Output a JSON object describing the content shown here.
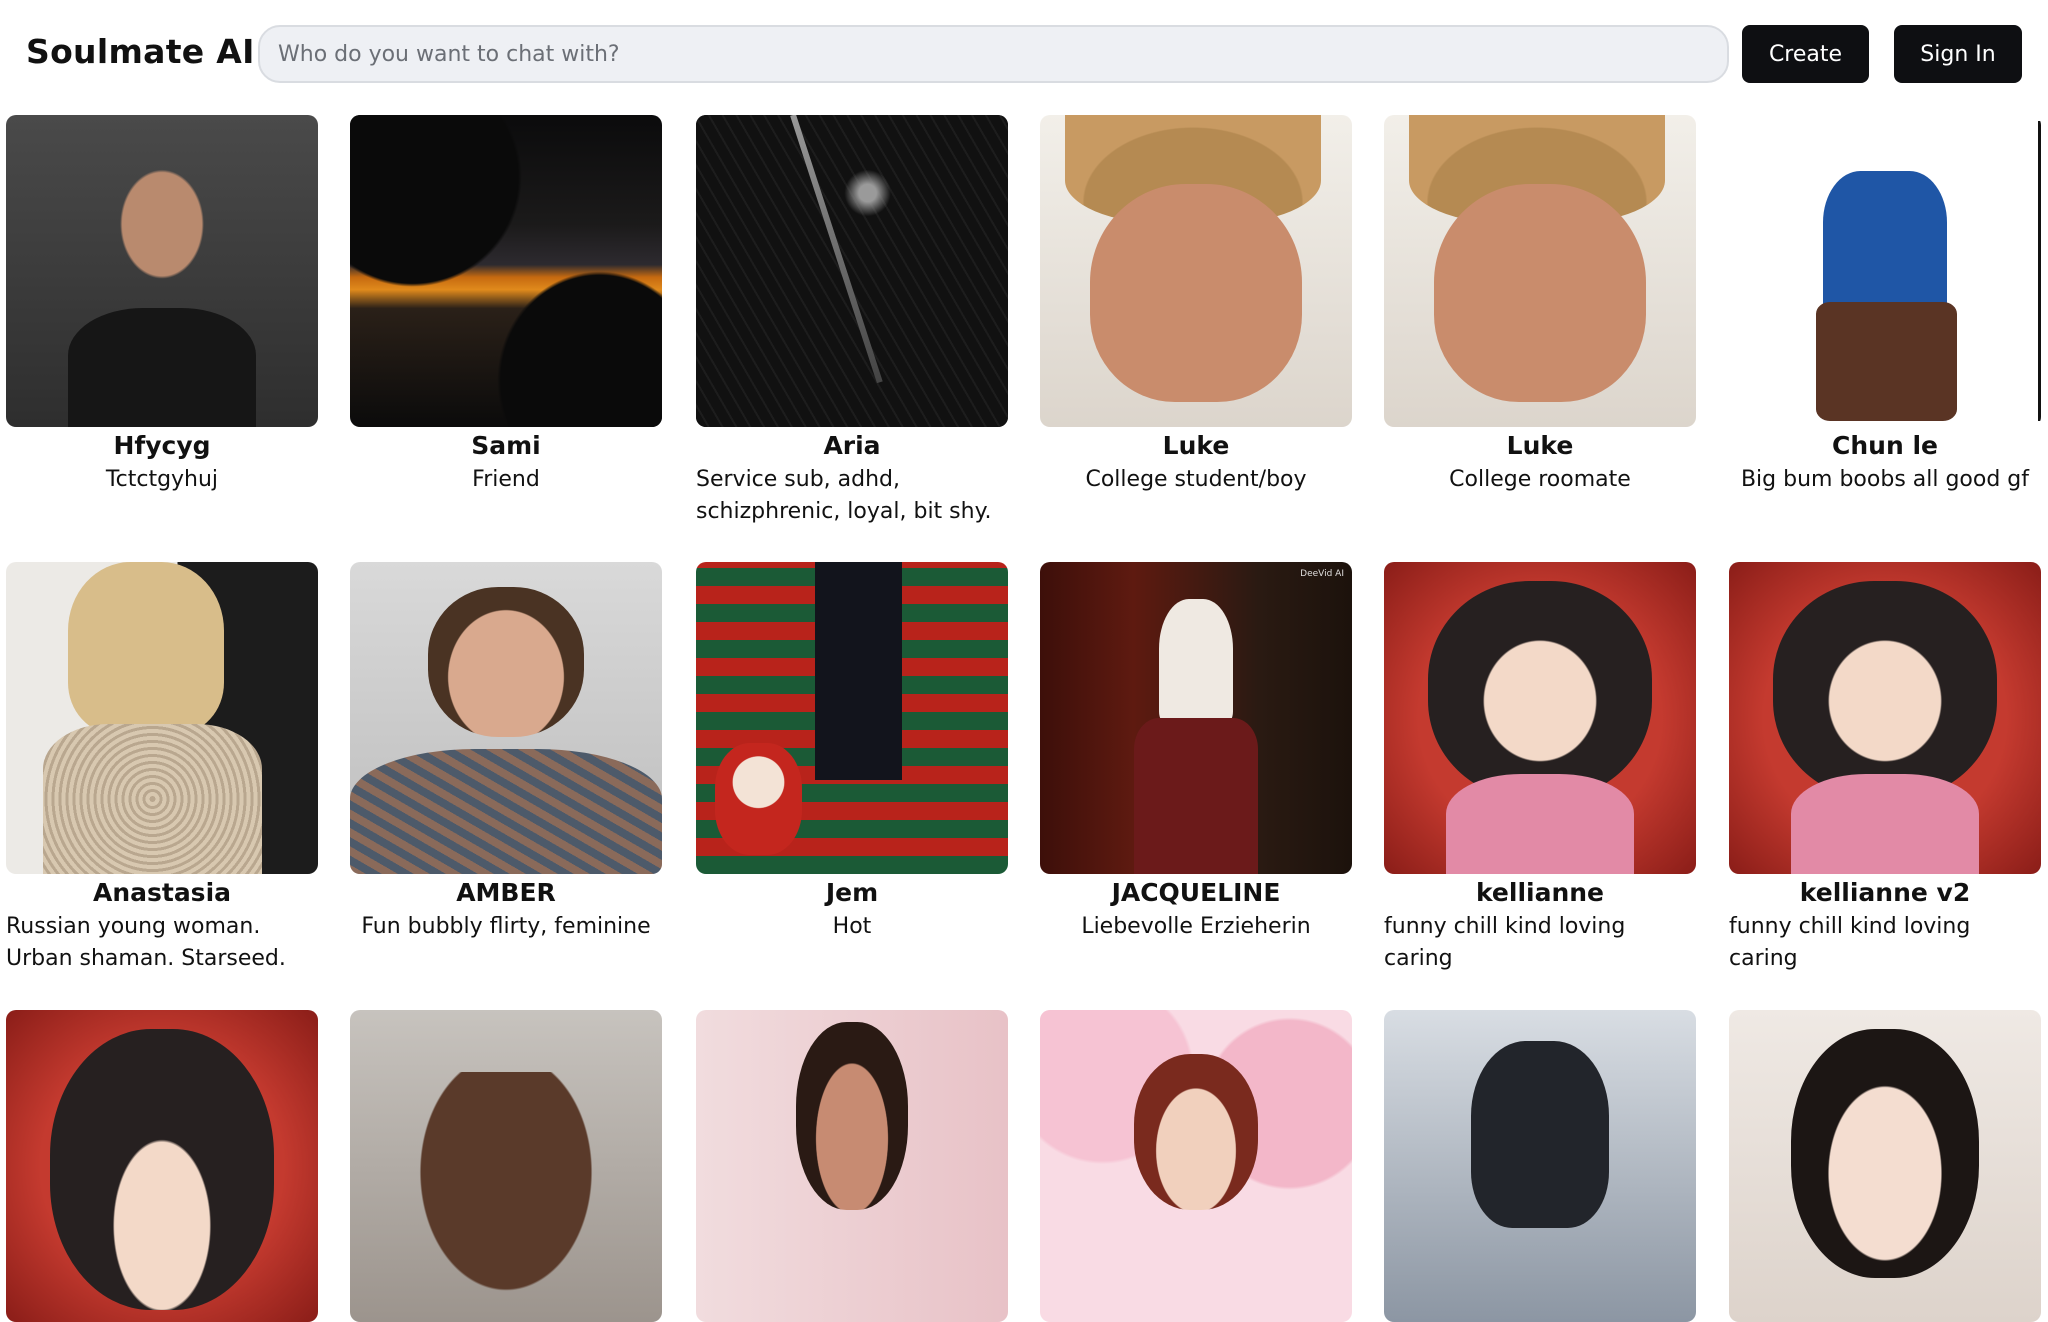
{
  "header": {
    "brand": "Soulmate AI",
    "search_placeholder": "Who do you want to chat with?",
    "create_label": "Create",
    "signin_label": "Sign In"
  },
  "characters": [
    {
      "name": "Hfycyg",
      "description": "Tctctgyhuj"
    },
    {
      "name": "Sami",
      "description": "Friend"
    },
    {
      "name": "Aria",
      "description": "Service sub, adhd, schizphrenic, loyal, bit shy."
    },
    {
      "name": "Luke",
      "description": "College student/boy"
    },
    {
      "name": "Luke",
      "description": "College roomate"
    },
    {
      "name": "Chun le",
      "description": "Big bum boobs all good gf"
    },
    {
      "name": "Anastasia",
      "description": "Russian young woman. Urban shaman. Starseed."
    },
    {
      "name": "AMBER",
      "description": "Fun bubbly flirty, feminine"
    },
    {
      "name": "Jem",
      "description": "Hot"
    },
    {
      "name": "JACQUELINE",
      "description": "Liebevolle Erzieherin",
      "watermark": "DeeVid AI"
    },
    {
      "name": "kellianne",
      "description": "funny chill kind loving caring"
    },
    {
      "name": "kellianne v2",
      "description": "funny chill kind loving caring"
    }
  ],
  "third_row_count": 6
}
